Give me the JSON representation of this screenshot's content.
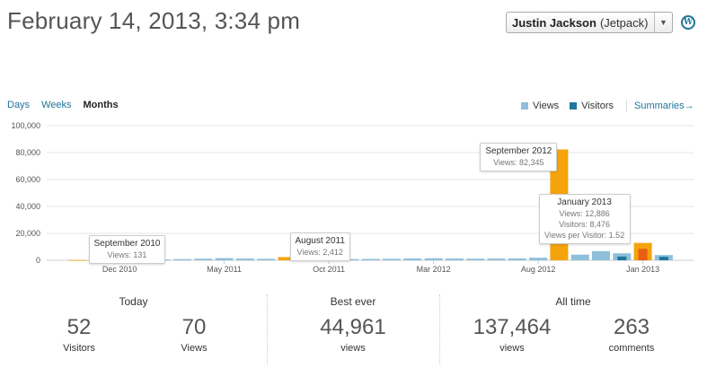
{
  "header": {
    "title": "February 14, 2013, 3:34 pm",
    "user_name": "Justin Jackson",
    "user_site": "(Jetpack)"
  },
  "tabs": [
    "Days",
    "Weeks",
    "Months"
  ],
  "active_tab": "Months",
  "legend": {
    "views_label": "Views",
    "visitors_label": "Visitors",
    "summaries_label": "Summaries→"
  },
  "colors": {
    "views": "#8ebfdb",
    "visitors": "#21759b",
    "highlight_views": "#f5a30c",
    "highlight_visitors": "#e75f12",
    "link": "#21759b"
  },
  "chart_data": {
    "type": "bar",
    "ylim": [
      0,
      100000
    ],
    "y_ticks": [
      "0",
      "20,000",
      "40,000",
      "60,000",
      "80,000",
      "100,000"
    ],
    "x_labels": [
      {
        "label": "Dec 2010",
        "index": 2
      },
      {
        "label": "May 2011",
        "index": 7
      },
      {
        "label": "Oct 2011",
        "index": 12
      },
      {
        "label": "Mar 2012",
        "index": 17
      },
      {
        "label": "Aug 2012",
        "index": 22
      },
      {
        "label": "Jan 2013",
        "index": 27
      }
    ],
    "series": [
      {
        "name": "Views",
        "values": [
          131,
          280,
          350,
          420,
          600,
          900,
          1200,
          1600,
          1300,
          1100,
          2412,
          1300,
          1100,
          900,
          1000,
          1100,
          1400,
          1500,
          1300,
          1200,
          1300,
          1400,
          1900,
          82345,
          4200,
          6800,
          5200,
          12886,
          3900
        ]
      },
      {
        "name": "Visitors",
        "values": [
          0,
          0,
          0,
          0,
          0,
          0,
          0,
          0,
          0,
          0,
          0,
          0,
          0,
          0,
          0,
          0,
          0,
          0,
          0,
          0,
          0,
          0,
          0,
          0,
          0,
          0,
          2800,
          8476,
          2600
        ]
      }
    ],
    "highlight": [
      0,
      10,
      23,
      27
    ],
    "tooltips": [
      {
        "index": 0,
        "title": "September 2010",
        "lines": [
          "Views: 131"
        ]
      },
      {
        "index": 10,
        "title": "August 2011",
        "lines": [
          "Views: 2,412"
        ]
      },
      {
        "index": 23,
        "title": "September 2012",
        "lines": [
          "Views: 82,345"
        ]
      },
      {
        "index": 27,
        "title": "January 2013",
        "lines": [
          "Views: 12,886",
          "Visitors: 8,476",
          "Views per Visitor: 1.52"
        ]
      }
    ]
  },
  "stats": {
    "today": {
      "heading": "Today",
      "visitors": "52",
      "visitors_label": "Visitors",
      "views": "70",
      "views_label": "Views"
    },
    "best_ever": {
      "heading": "Best ever",
      "views": "44,961",
      "views_label": "views"
    },
    "all_time": {
      "heading": "All time",
      "views": "137,464",
      "views_label": "views",
      "comments": "263",
      "comments_label": "comments"
    }
  }
}
